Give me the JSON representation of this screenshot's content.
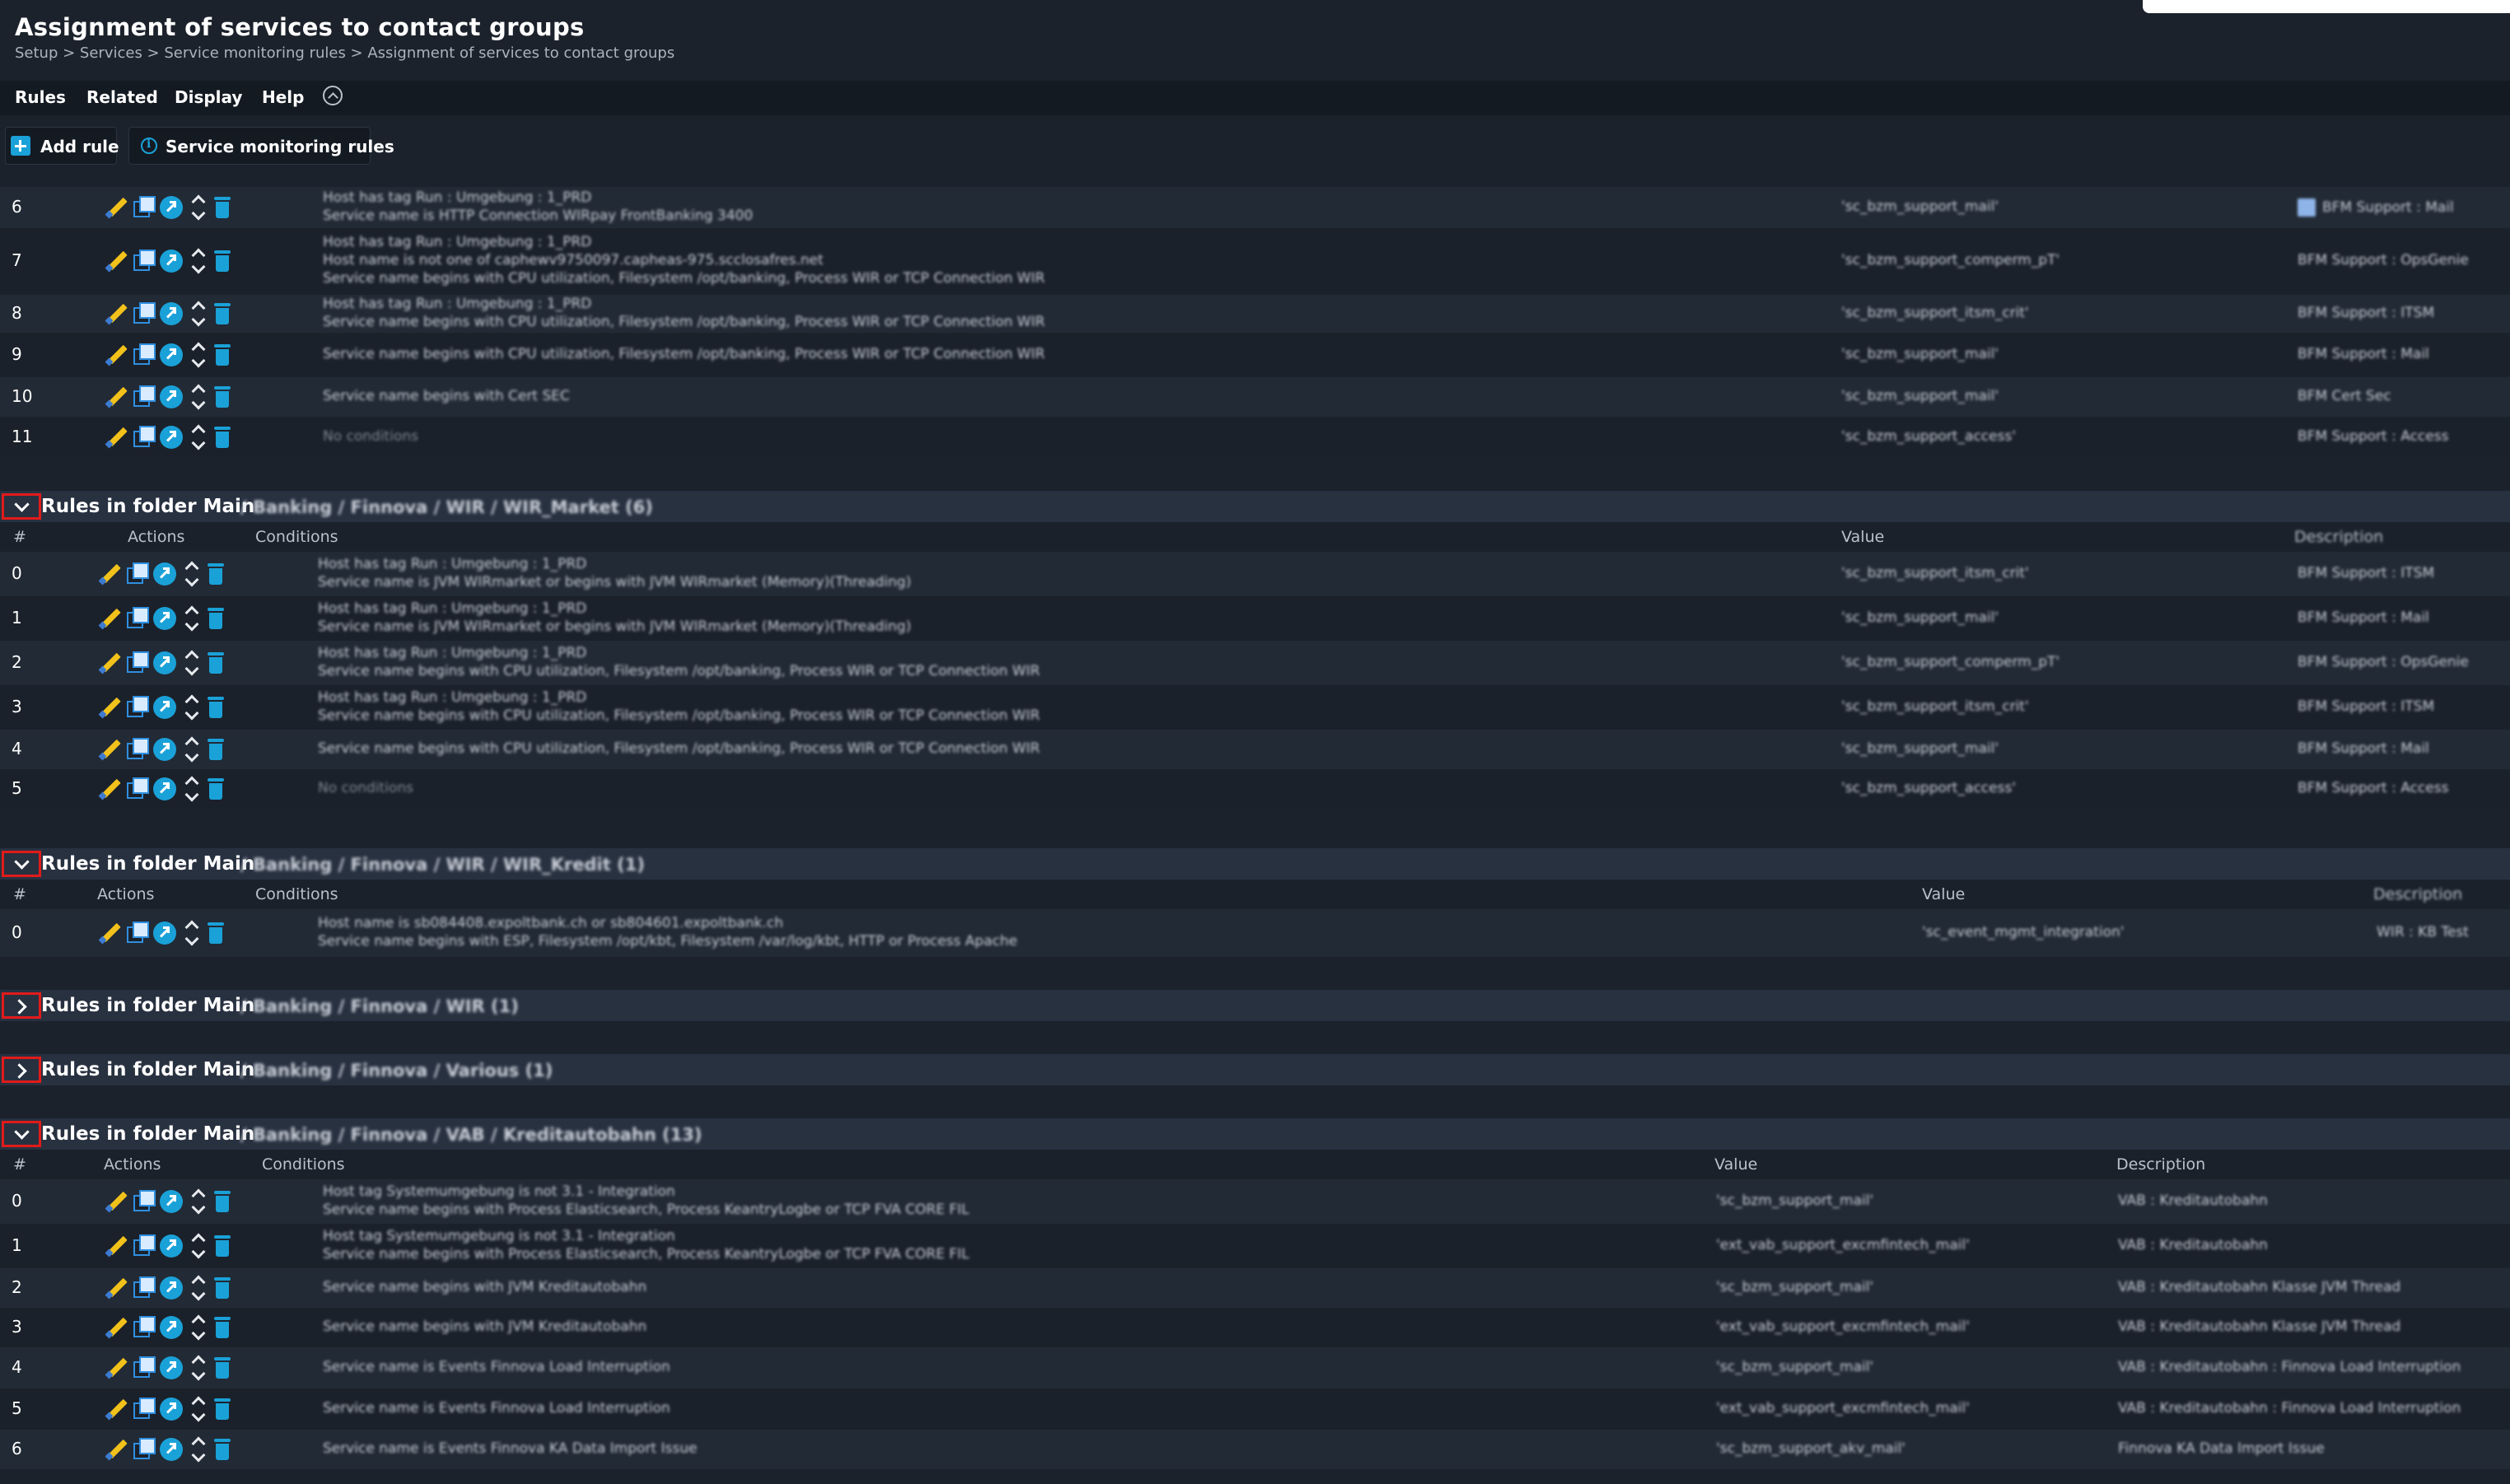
{
  "page": {
    "title": "Assignment of services to contact groups",
    "breadcrumb": "Setup > Services > Service monitoring rules > Assignment of services to contact groups"
  },
  "menu": {
    "rules": "Rules",
    "related": "Related",
    "display": "Display",
    "help": "Help"
  },
  "toolbar": {
    "add_rule": "Add rule",
    "service_monitoring_rules": "Service monitoring rules"
  },
  "columns": {
    "num": "#",
    "actions": "Actions",
    "conditions": "Conditions",
    "value": "Value",
    "description": "Description"
  },
  "top_rules": [
    {
      "num": "6",
      "c1": "Host has tag Run : Umgebung : 1_PRD",
      "c2": "Service name is HTTP Connection WIRpay FrontBanking 3400",
      "c3": "",
      "value": "'sc_bzm_support_mail'",
      "desc": "BFM Support : Mail",
      "icon": true
    },
    {
      "num": "7",
      "c1": "Host has tag Run : Umgebung : 1_PRD",
      "c2": "Host name is not one of caphewv9750097.capheas-975.scclosafres.net",
      "c3": "Service name begins with CPU utilization, Filesystem /opt/banking, Process WIR or TCP Connection WIR",
      "value": "'sc_bzm_support_comperm_pT'",
      "desc": "BFM Support : OpsGenie",
      "icon": false
    },
    {
      "num": "8",
      "c1": "Host has tag Run : Umgebung : 1_PRD",
      "c2": "Service name begins with CPU utilization, Filesystem /opt/banking, Process WIR or TCP Connection WIR",
      "c3": "",
      "value": "'sc_bzm_support_itsm_crit'",
      "desc": "BFM Support : ITSM",
      "icon": false
    },
    {
      "num": "9",
      "c1": "Service name begins with CPU utilization, Filesystem /opt/banking, Process WIR or TCP Connection WIR",
      "c2": "",
      "c3": "",
      "value": "'sc_bzm_support_mail'",
      "desc": "BFM Support : Mail",
      "icon": false
    },
    {
      "num": "10",
      "c1": "Service name begins with Cert SEC",
      "c2": "",
      "c3": "",
      "value": "'sc_bzm_support_mail'",
      "desc": "BFM Cert Sec",
      "icon": false
    },
    {
      "num": "11",
      "c1": "No conditions",
      "c2": "",
      "c3": "",
      "value": "'sc_bzm_support_access'",
      "desc": "BFM Support : Access",
      "icon": false
    }
  ],
  "folders": [
    {
      "expanded": true,
      "title": "Rules in folder Main",
      "path": "/ Banking / Finnova / WIR / WIR_Market (6)",
      "rules": [
        {
          "num": "0",
          "c1": "Host has tag Run : Umgebung : 1_PRD",
          "c2": "Service name is JVM WIRmarket or begins with JVM WIRmarket (Memory)(Threading)",
          "value": "'sc_bzm_support_itsm_crit'",
          "desc": "BFM Support : ITSM"
        },
        {
          "num": "1",
          "c1": "Host has tag Run : Umgebung : 1_PRD",
          "c2": "Service name is JVM WIRmarket or begins with JVM WIRmarket (Memory)(Threading)",
          "value": "'sc_bzm_support_mail'",
          "desc": "BFM Support : Mail"
        },
        {
          "num": "2",
          "c1": "Host has tag Run : Umgebung : 1_PRD",
          "c2": "Service name begins with CPU utilization, Filesystem /opt/banking, Process WIR or TCP Connection WIR",
          "value": "'sc_bzm_support_comperm_pT'",
          "desc": "BFM Support : OpsGenie"
        },
        {
          "num": "3",
          "c1": "Host has tag Run : Umgebung : 1_PRD",
          "c2": "Service name begins with CPU utilization, Filesystem /opt/banking, Process WIR or TCP Connection WIR",
          "value": "'sc_bzm_support_itsm_crit'",
          "desc": "BFM Support : ITSM"
        },
        {
          "num": "4",
          "c1": "Service name begins with CPU utilization, Filesystem /opt/banking, Process WIR or TCP Connection WIR",
          "c2": "",
          "value": "'sc_bzm_support_mail'",
          "desc": "BFM Support : Mail"
        },
        {
          "num": "5",
          "c1": "No conditions",
          "c2": "",
          "value": "'sc_bzm_support_access'",
          "desc": "BFM Support : Access"
        }
      ]
    },
    {
      "expanded": true,
      "title": "Rules in folder Main",
      "path": "/ Banking / Finnova / WIR / WIR_Kredit (1)",
      "rules": [
        {
          "num": "0",
          "c1": "Host name is sb084408.expoltbank.ch or sb804601.expoltbank.ch",
          "c2": "Service name begins with ESP, Filesystem /opt/kbt, Filesystem /var/log/kbt, HTTP or Process Apache",
          "value": "'sc_event_mgmt_integration'",
          "desc": "WIR : KB Test"
        }
      ]
    },
    {
      "expanded": false,
      "title": "Rules in folder Main",
      "path": "/ Banking / Finnova / WIR (1)"
    },
    {
      "expanded": false,
      "title": "Rules in folder Main",
      "path": "/ Banking / Finnova / Various (1)"
    },
    {
      "expanded": true,
      "title": "Rules in folder Main",
      "path": "/ Banking / Finnova / VAB / Kreditautobahn (13)",
      "rules": [
        {
          "num": "0",
          "c1": "Host tag Systemumgebung is not 3.1 - Integration",
          "c2": "Service name begins with Process Elasticsearch, Process KeantryLogbe or TCP FVA CORE FIL",
          "value": "'sc_bzm_support_mail'",
          "desc": "VAB : Kreditautobahn"
        },
        {
          "num": "1",
          "c1": "Host tag Systemumgebung is not 3.1 - Integration",
          "c2": "Service name begins with Process Elasticsearch, Process KeantryLogbe or TCP FVA CORE FIL",
          "value": "'ext_vab_support_excmfintech_mail'",
          "desc": "VAB : Kreditautobahn"
        },
        {
          "num": "2",
          "c1": "Service name begins with JVM Kreditautobahn",
          "c2": "",
          "value": "'sc_bzm_support_mail'",
          "desc": "VAB : Kreditautobahn Klasse JVM Thread"
        },
        {
          "num": "3",
          "c1": "Service name begins with JVM Kreditautobahn",
          "c2": "",
          "value": "'ext_vab_support_excmfintech_mail'",
          "desc": "VAB : Kreditautobahn Klasse JVM Thread"
        },
        {
          "num": "4",
          "c1": "Service name is Events Finnova Load Interruption",
          "c2": "",
          "value": "'sc_bzm_support_mail'",
          "desc": "VAB : Kreditautobahn : Finnova Load Interruption"
        },
        {
          "num": "5",
          "c1": "Service name is Events Finnova Load Interruption",
          "c2": "",
          "value": "'ext_vab_support_excmfintech_mail'",
          "desc": "VAB : Kreditautobahn : Finnova Load Interruption"
        },
        {
          "num": "6",
          "c1": "Service name is Events Finnova KA Data Import Issue",
          "c2": "",
          "value": "'sc_bzm_support_akv_mail'",
          "desc": "Finnova KA Data Import Issue"
        }
      ]
    }
  ]
}
